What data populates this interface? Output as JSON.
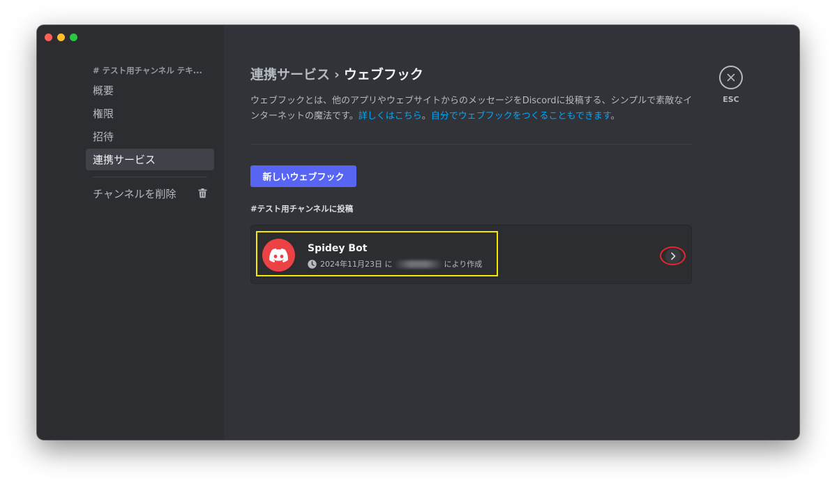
{
  "sidebar": {
    "header": "# テスト用チャンネル テキ...",
    "items": [
      {
        "label": "概要"
      },
      {
        "label": "権限"
      },
      {
        "label": "招待"
      },
      {
        "label": "連携サービス",
        "active": true
      }
    ],
    "delete_label": "チャンネルを削除"
  },
  "main": {
    "breadcrumb_parent": "連携サービス",
    "breadcrumb_separator": "›",
    "breadcrumb_current": "ウェブフック",
    "description_text": "ウェブフックとは、他のアプリやウェブサイトからのメッセージをDiscordに投稿する、シンプルで素敵なインターネットの魔法です。",
    "description_link1": "詳しくはこちら",
    "description_sep": "。",
    "description_link2": "自分でウェブフックをつくることもできます",
    "description_end": "。",
    "new_webhook_button": "新しいウェブフック",
    "section_label": "#テスト用チャンネルに投稿",
    "webhook": {
      "name": "Spidey Bot",
      "created_date": "2024年11月23日 に",
      "created_suffix": "により作成"
    },
    "close_label": "ESC"
  },
  "colors": {
    "accent": "#5865f2",
    "link": "#00a8fc",
    "avatar": "#ed4245",
    "highlight": "#f6e600",
    "circle_annotation": "#e5262d"
  }
}
